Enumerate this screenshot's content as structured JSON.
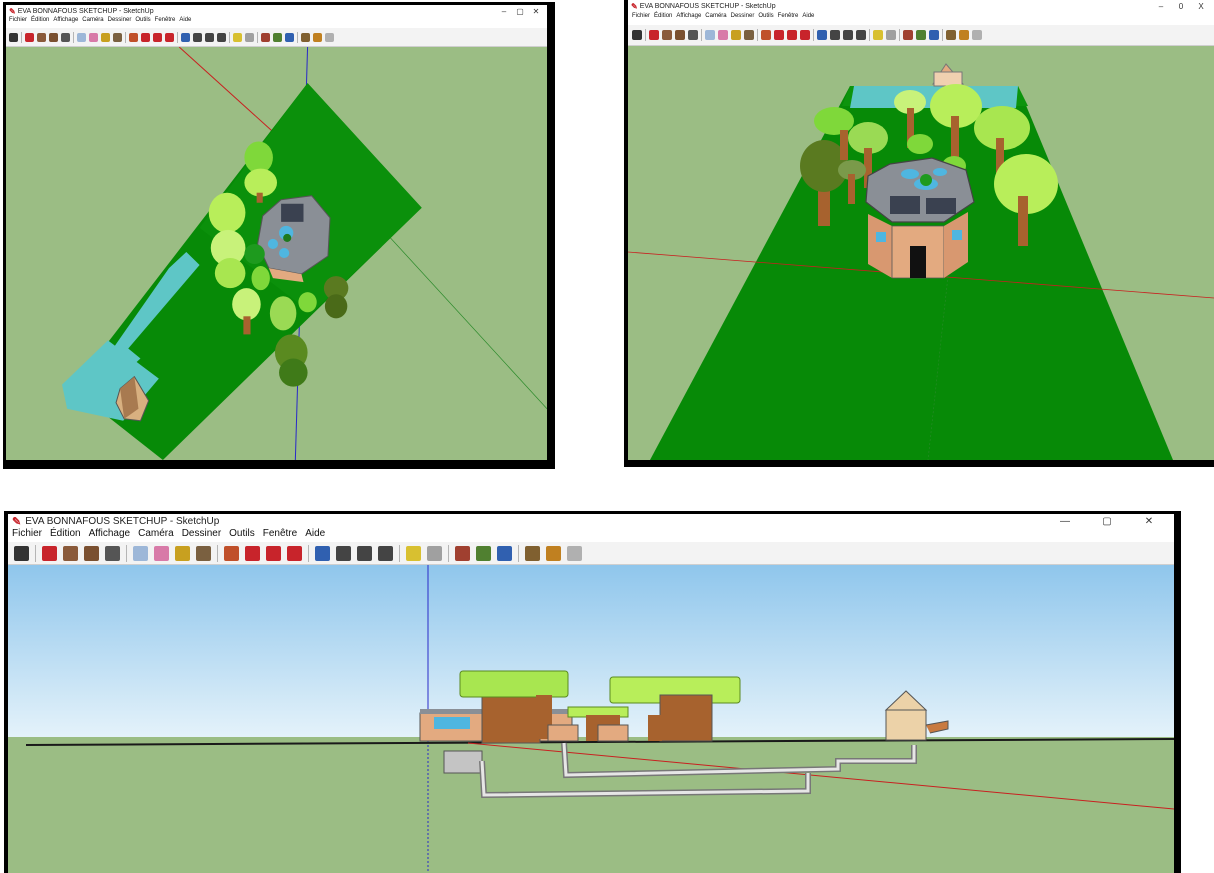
{
  "windows": [
    {
      "id": "topdown",
      "title": "EVA BONNAFOUS SKETCHUP - SketchUp",
      "menu": [
        "Fichier",
        "Édition",
        "Affichage",
        "Caméra",
        "Dessiner",
        "Outils",
        "Fenêtre",
        "Aide"
      ],
      "window_buttons": [
        "–",
        "▢",
        "✕"
      ]
    },
    {
      "id": "perspective",
      "title": "EVA BONNAFOUS SKETCHUP - SketchUp",
      "menu": [
        "Fichier",
        "Édition",
        "Affichage",
        "Caméra",
        "Dessiner",
        "Outils",
        "Fenêtre",
        "Aide"
      ],
      "window_buttons": [
        "–",
        "0",
        "X"
      ]
    },
    {
      "id": "section",
      "title": "EVA BONNAFOUS SKETCHUP - SketchUp",
      "menu": [
        "Fichier",
        "Édition",
        "Affichage",
        "Caméra",
        "Dessiner",
        "Outils",
        "Fenêtre",
        "Aide"
      ],
      "window_buttons": [
        "—",
        "▢",
        "✕"
      ]
    }
  ],
  "toolbar_tools": [
    {
      "name": "select-tool-icon",
      "color": "#333333"
    },
    {
      "sep": true
    },
    {
      "name": "line-tool-icon",
      "color": "#c8242b"
    },
    {
      "name": "rectangle-tool-icon",
      "color": "#8a5a3a"
    },
    {
      "name": "circle-tool-icon",
      "color": "#7a5030"
    },
    {
      "name": "arc-tool-icon",
      "color": "#555555"
    },
    {
      "sep": true
    },
    {
      "name": "make-component-icon",
      "color": "#9db7d8"
    },
    {
      "name": "eraser-tool-icon",
      "color": "#d87aa8"
    },
    {
      "name": "tape-measure-icon",
      "color": "#c8a020"
    },
    {
      "name": "paint-bucket-icon",
      "color": "#7a6040"
    },
    {
      "sep": true
    },
    {
      "name": "push-pull-icon",
      "color": "#c0502a"
    },
    {
      "name": "move-tool-icon",
      "color": "#c8242b"
    },
    {
      "name": "rotate-tool-icon",
      "color": "#c8242b"
    },
    {
      "name": "offset-tool-icon",
      "color": "#c8242b"
    },
    {
      "sep": true
    },
    {
      "name": "orbit-tool-icon",
      "color": "#3060b0"
    },
    {
      "name": "pan-tool-icon",
      "color": "#444444"
    },
    {
      "name": "zoom-tool-icon",
      "color": "#444444"
    },
    {
      "name": "zoom-extents-icon",
      "color": "#444444"
    },
    {
      "sep": true
    },
    {
      "name": "scenes-icon",
      "color": "#d8c030"
    },
    {
      "name": "components-icon",
      "color": "#a0a0a0"
    },
    {
      "sep": true
    },
    {
      "name": "warehouse-icon",
      "color": "#a04030"
    },
    {
      "name": "share-model-icon",
      "color": "#508030"
    },
    {
      "name": "extension-icon",
      "color": "#3060b0"
    },
    {
      "sep": true
    },
    {
      "name": "get-photo-icon",
      "color": "#806030"
    },
    {
      "name": "styles-icon",
      "color": "#c08020"
    },
    {
      "name": "sandbox-icon",
      "color": "#b0b0b0"
    }
  ],
  "colors": {
    "ground": "#9bbd84",
    "lawn": "#078a07",
    "lawn_light": "#1e9a1e",
    "water": "#5ec6c6",
    "sky_top": "#8fc6ec",
    "sky_bottom": "#dff0fa",
    "tree_light": "#b8ee5a",
    "tree_mid": "#7fd83a",
    "tree_dark": "#5a7a20",
    "trunk": "#a7622e",
    "house_wall": "#e3aa80",
    "roof": "#8a8f96",
    "axis_red": "#c82020",
    "axis_green": "#2a8a2a",
    "axis_blue": "#2a2ac8"
  }
}
